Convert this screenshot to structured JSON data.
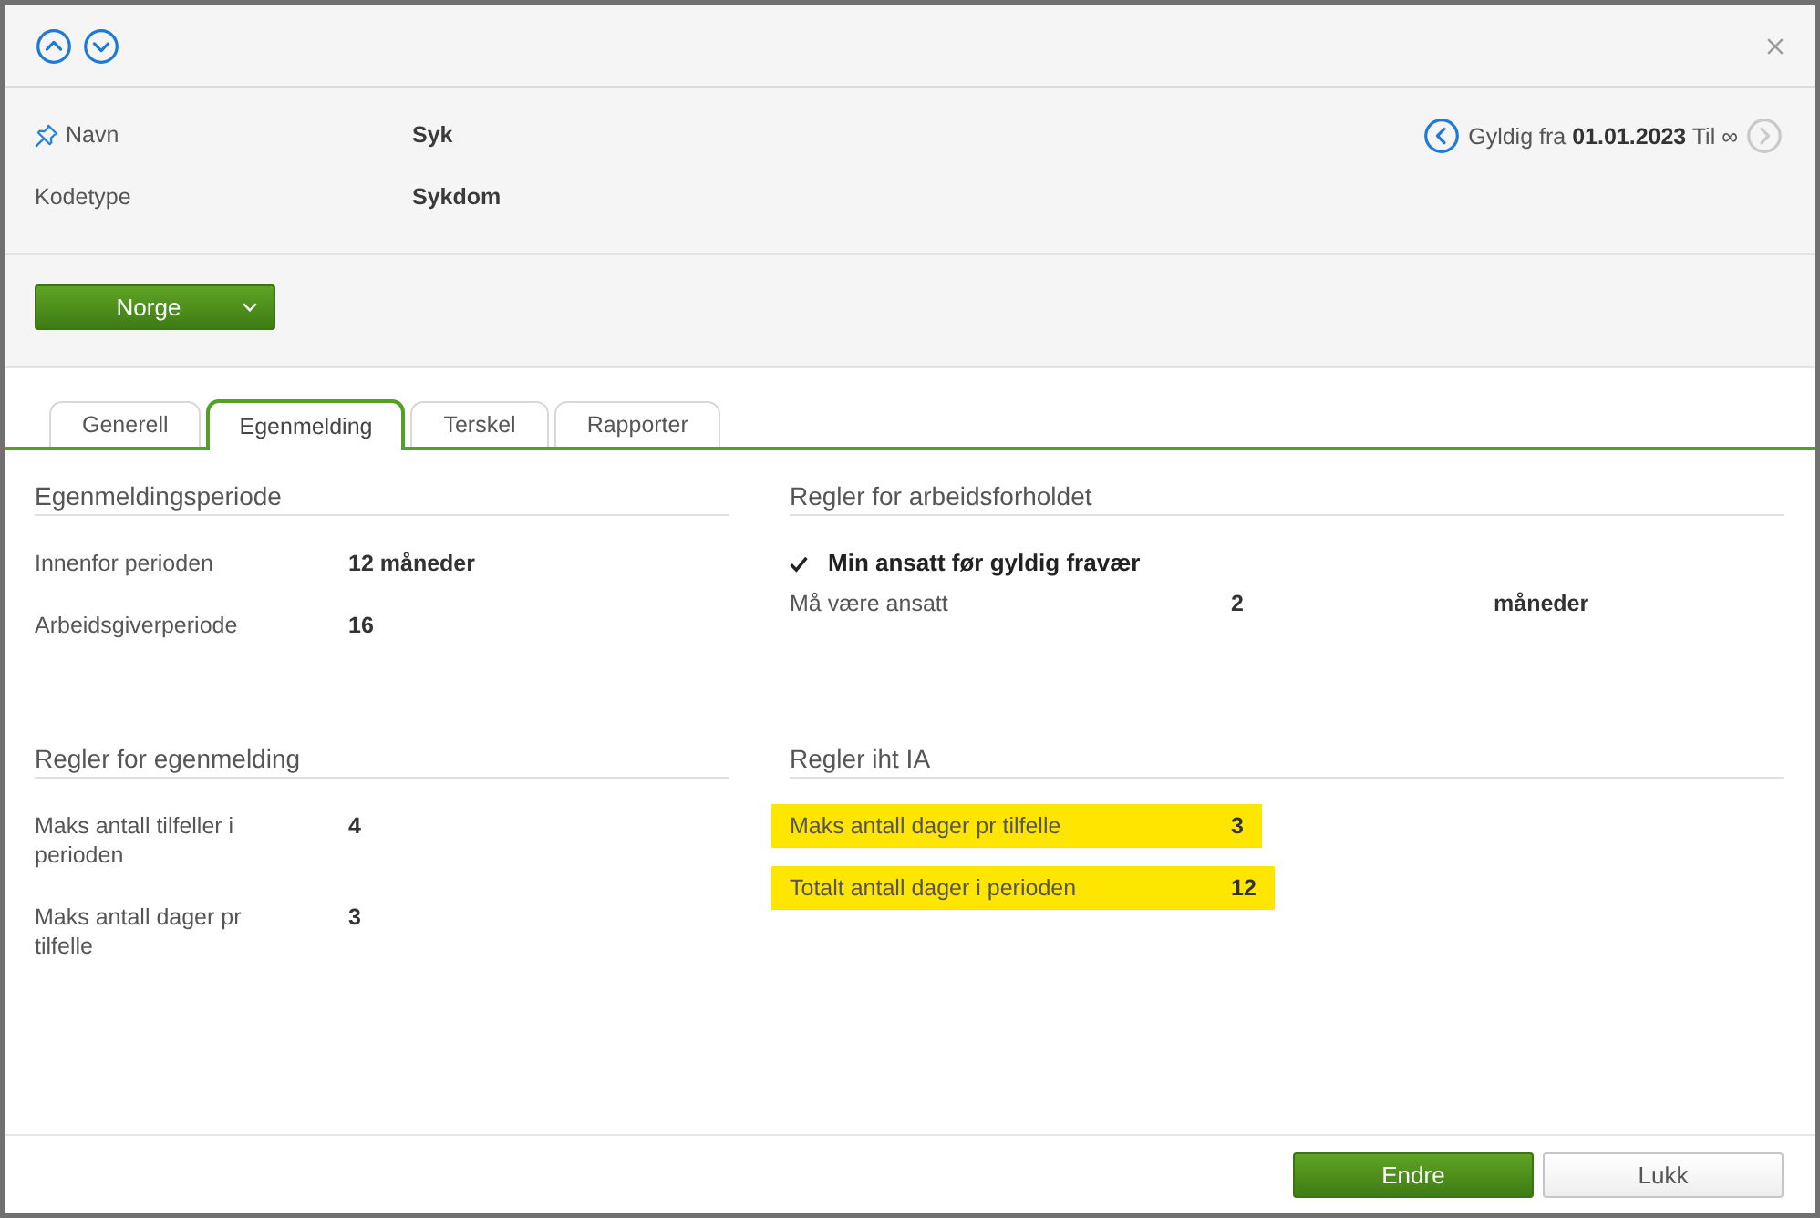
{
  "record": {
    "fields": [
      {
        "label": "Navn",
        "value": "Syk",
        "pinned": true
      },
      {
        "label": "Kodetype",
        "value": "Sykdom",
        "pinned": false
      }
    ],
    "validity": {
      "text": "Gyldig fra **01.01.2023** Til ∞",
      "previous": {
        "disabled": false
      },
      "next": {
        "disabled": true
      }
    }
  },
  "country_selector": {
    "label": "Norge"
  },
  "tabs": [
    {
      "label": "Generell",
      "selected": false
    },
    {
      "label": "Egenmelding",
      "selected": true
    },
    {
      "label": "Terskel",
      "selected": false
    },
    {
      "label": "Rapporter",
      "selected": false
    }
  ],
  "sections": [
    {
      "title": "Egenmeldingsperiode",
      "rows": [
        {
          "kind": "field",
          "label": "Innenfor perioden",
          "value": "12 måneder"
        },
        {
          "kind": "field",
          "label": "Arbeidsgiverperiode",
          "value": "16"
        }
      ]
    },
    {
      "title": "Regler for arbeidsforholdet",
      "rows": [
        {
          "kind": "check",
          "label": "Min ansatt før gyldig fravær",
          "checked": true
        },
        {
          "kind": "field",
          "label": "Må være ansatt",
          "value": "2",
          "unit": "måneder"
        }
      ]
    },
    {
      "title": "Regler for egenmelding",
      "rows": [
        {
          "kind": "field",
          "label": "Maks antall tilfeller i perioden",
          "value": "4"
        },
        {
          "kind": "field",
          "label": "Maks antall dager pr tilfelle",
          "value": "3"
        }
      ]
    },
    {
      "title": "Regler iht IA",
      "rows": [
        {
          "kind": "field",
          "label": "Maks antall dager pr tilfelle",
          "value": "3",
          "highlighted": true
        },
        {
          "kind": "field",
          "label": "Totalt antall dager i perioden",
          "value": "12",
          "highlighted": true
        }
      ]
    }
  ],
  "footer": {
    "buttons": [
      {
        "label": "Endre",
        "kind": "primary"
      },
      {
        "label": "Lukk",
        "kind": "secondary"
      }
    ]
  }
}
